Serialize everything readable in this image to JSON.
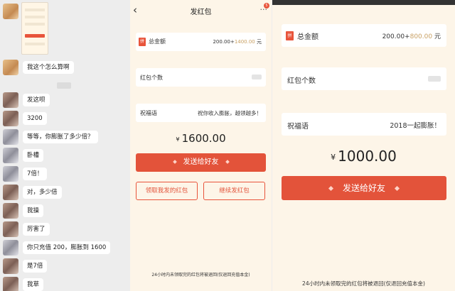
{
  "chat": {
    "messages": [
      {
        "text": "我这个怎么算啊"
      },
      {
        "text": "发这呗"
      },
      {
        "text": "3200"
      },
      {
        "text": "等等，你膨胀了多少倍？"
      },
      {
        "text": "卧槽"
      },
      {
        "text": "7倍！"
      },
      {
        "text": "对，多少倍"
      },
      {
        "text": "我操"
      },
      {
        "text": "厉害了"
      },
      {
        "text": "你只充值 200，膨胀到 1600"
      },
      {
        "text": "是7倍"
      },
      {
        "text": "我草"
      }
    ]
  },
  "middle": {
    "title": "发红包",
    "back_glyph": "‹",
    "more_glyph": "···",
    "badge": "5",
    "pin_glyph": "拼",
    "total_label": "总金额",
    "total_base": "200.00+",
    "total_bonus": "1400.00",
    "total_unit": "元",
    "count_label": "红包个数",
    "greeting_label": "祝福语",
    "greeting_value": "祝你收入膨胀，越领越多！",
    "yen": "¥",
    "amount": "1600.00",
    "send_label": "发送给好友",
    "my_packets_label": "领取我发的红包",
    "continue_label": "继续发红包",
    "footnote": "24小时内未领取完的红包将被退回(仅退回充值本金)"
  },
  "right": {
    "pin_glyph": "拼",
    "total_label": "总金额",
    "total_base": "200.00+",
    "total_bonus": "800.00",
    "total_unit": "元",
    "count_label": "红包个数",
    "greeting_label": "祝福语",
    "greeting_value": "2018一起膨胀！",
    "yen": "¥",
    "amount": "1000.00",
    "send_label": "发送给好友",
    "footnote": "24小时内未领取完的红包将被退回(仅退回充值本金)"
  },
  "colors": {
    "accent": "#e3533a",
    "bonus_gold": "#c9a063",
    "page_bg": "#fdf5e8",
    "chat_bg": "#ededed"
  }
}
